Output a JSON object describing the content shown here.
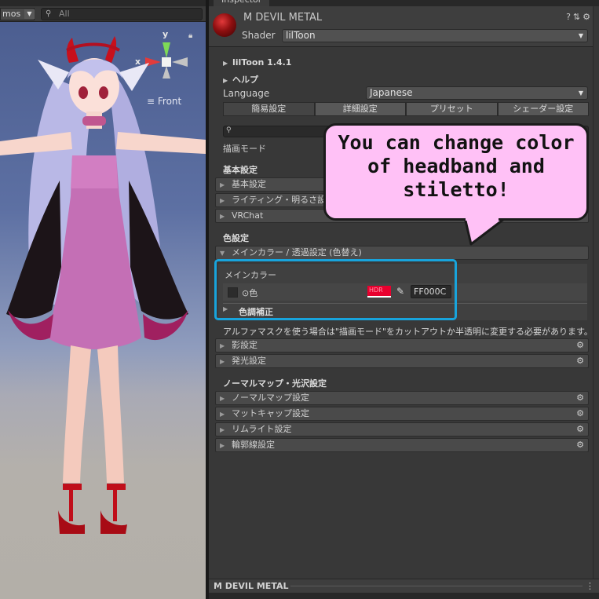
{
  "scene": {
    "toolbar": {
      "gizmos_label": "mos",
      "search_placeholder": "All"
    },
    "axes": {
      "y": "y",
      "x": "x"
    },
    "view_label": "Front"
  },
  "inspector": {
    "tab_title": "Inspector",
    "material_name": "M DEVIL METAL",
    "shader_label": "Shader",
    "shader_value": "lilToon",
    "version_fold": "lilToon 1.4.1",
    "help_fold": "ヘルプ",
    "language_label": "Language",
    "language_value": "Japanese",
    "tabs": [
      "簡易設定",
      "詳細設定",
      "プリセット",
      "シェーダー設定"
    ],
    "render_mode_label": "描画モード",
    "basic_section": {
      "title": "基本設定",
      "items": [
        "基本設定",
        "ライティング・明るさ設定",
        "VRChat"
      ]
    },
    "color_section": {
      "title": "色設定",
      "main_color_bar": "メインカラー / 透過設定 (色替え)",
      "main_color_title": "メインカラー",
      "color_label": "色",
      "swatch_text": "HDR",
      "swatch_color": "#e8002e",
      "hex_value": "FF000C",
      "tone_label": "色調補正",
      "alpha_note": "アルファマスクを使う場合は\"描画モード\"をカットアウトか半透明に変更する必要があります。",
      "items": [
        "影設定",
        "発光設定"
      ]
    },
    "normal_section": {
      "title": "ノーマルマップ・光沢設定",
      "items": [
        "ノーマルマップ設定",
        "マットキャップ設定",
        "リムライト設定",
        "輪郭線設定"
      ]
    },
    "footer_label": "M DEVIL METAL"
  },
  "callout": {
    "text": "You can change color\nof headband and\nstiletto!",
    "fill": "#ffc1f6"
  },
  "highlight_color": "#18a4dc"
}
